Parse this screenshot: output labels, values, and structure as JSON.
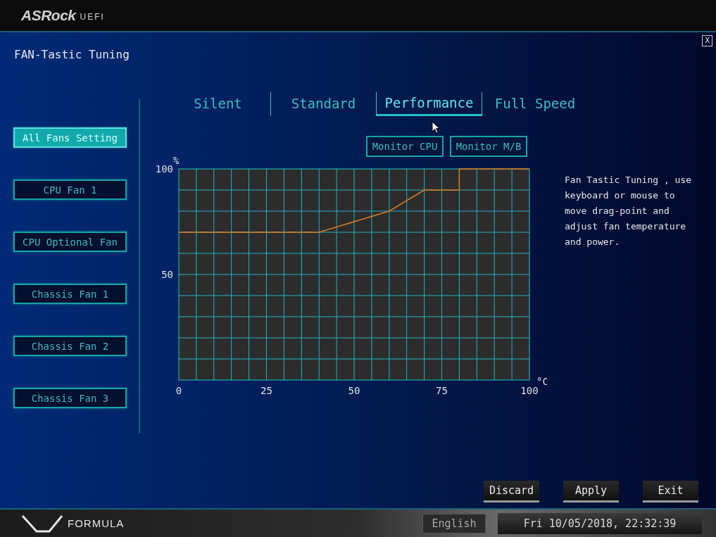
{
  "header": {
    "brand": "ASRock",
    "product": "UEFI"
  },
  "page": {
    "title": "FAN-Tastic Tuning",
    "close": "X"
  },
  "fans": [
    {
      "label": "All Fans Setting",
      "selected": true
    },
    {
      "label": "CPU Fan 1",
      "selected": false
    },
    {
      "label": "CPU Optional Fan",
      "selected": false
    },
    {
      "label": "Chassis Fan 1",
      "selected": false
    },
    {
      "label": "Chassis Fan 2",
      "selected": false
    },
    {
      "label": "Chassis Fan 3",
      "selected": false
    }
  ],
  "modes": [
    {
      "label": "Silent",
      "selected": false
    },
    {
      "label": "Standard",
      "selected": false
    },
    {
      "label": "Performance",
      "selected": true
    },
    {
      "label": "Full Speed",
      "selected": false
    }
  ],
  "monitor_buttons": [
    "Monitor CPU",
    "Monitor M/B"
  ],
  "chart": {
    "chart_data": {
      "type": "line",
      "xlabel": "°C",
      "ylabel": "%",
      "x": [
        0,
        40,
        60,
        70,
        80,
        80,
        100
      ],
      "xlim": [
        0,
        100
      ],
      "ylim": [
        0,
        100
      ],
      "xticks": [
        0,
        25,
        50,
        75,
        100
      ],
      "yticks": [
        50,
        100
      ],
      "grid": true,
      "series": [
        {
          "color": "#e07a1f",
          "values": [
            70,
            70,
            80,
            90,
            90,
            100,
            100
          ]
        }
      ]
    }
  },
  "description": "Fan Tastic Tuning , use keyboard or mouse to move drag-point and adjust fan temperature and power.",
  "actions": [
    "Discard",
    "Apply",
    "Exit"
  ],
  "footer": {
    "logo": "FORMULA",
    "language": "English",
    "datetime": "Fri 10/05/2018, 22:32:39"
  }
}
